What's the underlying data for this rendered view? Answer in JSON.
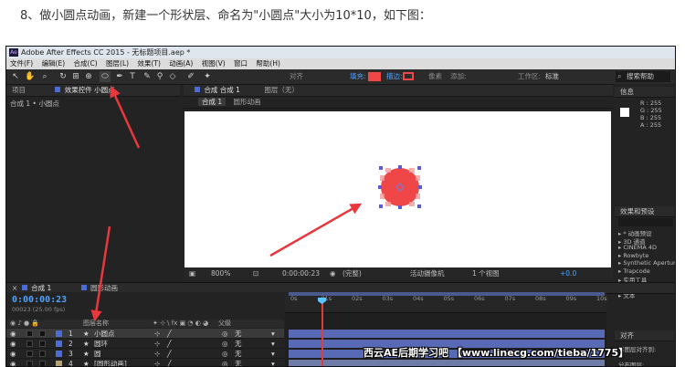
{
  "caption": "8、做小圆点动画，新建一个形状层、命名为\"小圆点\"大小为10*10，如下图：",
  "app": {
    "title": "Adobe After Effects CC 2015 - 无标题项目.aep *",
    "logo": "Ae",
    "menu": [
      "文件(F)",
      "编辑(E)",
      "合成(C)",
      "图层(L)",
      "效果(T)",
      "动画(A)",
      "视图(V)",
      "窗口",
      "帮助(H)"
    ]
  },
  "toolbar": {
    "align_label": "对齐",
    "fill_label": "填充:",
    "stroke_label": "描边:",
    "px_label": "像素",
    "add_label": "添加:",
    "workspace_label": "工作区:",
    "workspace_value": "标准",
    "search_label": "搜索帮助",
    "fill_color": "#ef4747",
    "stroke_color": "#ef4747"
  },
  "project_panel": {
    "tab_project": "项目",
    "tab_effects": "效果控件 小圆点",
    "breadcrumb": "合成 1 • 小圆点"
  },
  "comp_panel": {
    "tab_comp": "合成 合成 1",
    "tab_layer": "图层（无）",
    "sub_tab_active": "合成 1",
    "sub_tab_other": "圆形动画"
  },
  "viewer_bottom": {
    "zoom": "800%",
    "timecode": "0:00:00:23",
    "resolution": "(完整)",
    "camera": "活动摄像机",
    "views": "1 个视图",
    "exposure": "+0.0"
  },
  "info_panel": {
    "title": "信息",
    "r": "R : 255",
    "g": "G : 255",
    "b": "B : 255",
    "a": "A : 255"
  },
  "effects_panel": {
    "title": "效果和预设",
    "items": [
      "▸ * 动画预设",
      "▸ 3D 通道",
      "▸ CINEMA 4D",
      "▸ Rowbyte",
      "▸ Synthetic Aperture",
      "▸ Trapcode",
      "▸ 实用工具",
      "▸ 扭曲",
      "▸ 文本"
    ]
  },
  "align_panel": {
    "title": "对齐",
    "align_to": "将图层对齐到:",
    "distribute": "分布图层:"
  },
  "timeline": {
    "tab_comp": "合成 1",
    "tab_other": "圆形动画",
    "timecode": "0:00:00:23",
    "fps": "00023 (25.00 fps)",
    "col_layer_name": "图层名称",
    "col_parent": "父级",
    "ruler_ticks": [
      "0s",
      "01s",
      "02s",
      "03s",
      "04s",
      "05s",
      "06s",
      "07s",
      "08s",
      "09s",
      "10s"
    ],
    "layers": [
      {
        "num": "1",
        "name": "小圆点",
        "parent": "无",
        "color": "#4c6bd6"
      },
      {
        "num": "2",
        "name": "圆环",
        "parent": "无",
        "color": "#4c6bd6"
      },
      {
        "num": "3",
        "name": "圆",
        "parent": "无",
        "color": "#4c6bd6"
      },
      {
        "num": "4",
        "name": "[圆形动画]",
        "parent": "无",
        "color": "#b7a36a"
      }
    ]
  },
  "circle_color": "#ef4747",
  "arrow_color": "#e8383d",
  "watermark": "西云AE后期学习吧 【www.linecg.com/tieba/1775】"
}
